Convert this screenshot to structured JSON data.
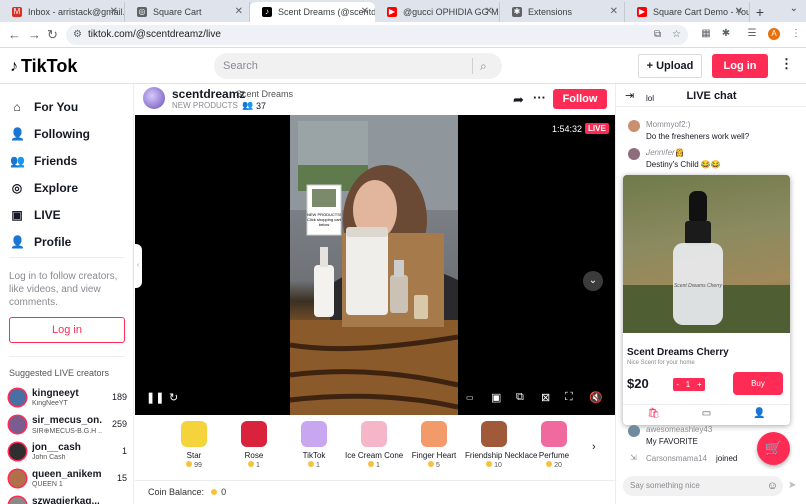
{
  "browser": {
    "tabs": [
      {
        "title": "Inbox - arristack@gmail.c",
        "icon": "gmail-icon",
        "color": "#d93025",
        "glyph": "M"
      },
      {
        "title": "Square Cart",
        "icon": "globe-icon",
        "color": "#5f6368",
        "glyph": "◎"
      },
      {
        "title": "Scent Dreams (@scentdre",
        "icon": "tiktok-icon",
        "color": "#000000",
        "glyph": "♪"
      },
      {
        "title": "@gucci OPHIDIA GG MIN",
        "icon": "youtube-icon",
        "color": "#ff0000",
        "glyph": "▶"
      },
      {
        "title": "Extensions",
        "icon": "puzzle-icon",
        "color": "#5f6368",
        "glyph": "✱"
      },
      {
        "title": "Square Cart Demo - YouT",
        "icon": "youtube-icon",
        "color": "#ff0000",
        "glyph": "▶"
      }
    ],
    "active_tab": 2,
    "new_tab": "+",
    "url": "tiktok.com/@scentdreamz/live",
    "profile_initial": "A"
  },
  "header": {
    "logo_text": "TikTok",
    "search_placeholder": "Search",
    "upload_label": "Upload",
    "login_label": "Log in"
  },
  "sidebar": {
    "nav": [
      {
        "label": "For You",
        "icon": "home-icon",
        "glyph": "⌂"
      },
      {
        "label": "Following",
        "icon": "user-follow-icon",
        "glyph": "👤"
      },
      {
        "label": "Friends",
        "icon": "friends-icon",
        "glyph": "👥"
      },
      {
        "label": "Explore",
        "icon": "compass-icon",
        "glyph": "◎"
      },
      {
        "label": "LIVE",
        "icon": "live-icon",
        "glyph": "▣"
      },
      {
        "label": "Profile",
        "icon": "profile-icon",
        "glyph": "👤"
      }
    ],
    "login_note": "Log in to follow creators, like videos, and view comments.",
    "login_button": "Log in",
    "suggested_title": "Suggested LIVE creators",
    "creators": [
      {
        "name": "kingneeyt",
        "sub": "KingNeeYT",
        "count": "189",
        "color": "#4a6fa5"
      },
      {
        "name": "sir_mecus_on...",
        "sub": "SIR⊕MECUS-B.G.H ...",
        "count": "259",
        "color": "#7a5c8e"
      },
      {
        "name": "jon__cash",
        "sub": "John Cash",
        "count": "1",
        "color": "#2f2f2f"
      },
      {
        "name": "queen_anikemi",
        "sub": "QUEEN 1",
        "count": "15",
        "color": "#b0704a"
      },
      {
        "name": "szwagierkag...",
        "sub": "",
        "count": "",
        "color": "#8a8a8a"
      }
    ]
  },
  "host": {
    "username": "scentdreamz",
    "nickname": "Scent Dreams",
    "tag": "NEW PRODUCTS",
    "viewers": "37",
    "follow_label": "Follow"
  },
  "video": {
    "elapsed": "1:54:32",
    "live_badge": "LIVE",
    "sign_text": "NEW PRODUCTS! Click shopping cart below"
  },
  "gifts": [
    {
      "name": "Star",
      "price": "99",
      "color": "#f5d33b"
    },
    {
      "name": "Rose",
      "price": "1",
      "color": "#d9233c"
    },
    {
      "name": "TikTok",
      "price": "1",
      "color": "#c9a6f0"
    },
    {
      "name": "Ice Cream Cone",
      "price": "1",
      "color": "#f4b6c8"
    },
    {
      "name": "Finger Heart",
      "price": "5",
      "color": "#f39a6b"
    },
    {
      "name": "Friendship Necklace",
      "price": "10",
      "color": "#a05a3a"
    },
    {
      "name": "Perfume",
      "price": "20",
      "color": "#f06aa0"
    }
  ],
  "coin_balance_label": "Coin Balance:",
  "coin_balance": "0",
  "chat": {
    "title": "LIVE chat",
    "messages": [
      {
        "user": "",
        "text": "lol",
        "color": "#c9c9c9"
      },
      {
        "user": "Mommyof2:)",
        "text": "Do the fresheners work well?",
        "color": "#c98f6e"
      },
      {
        "user": "𝐽𝑒𝑛𝑛𝑖𝑓𝑒𝑟👸",
        "text": "Destiny's Child 😂😂",
        "color": "#8e6c7c"
      }
    ],
    "lower_messages": [
      {
        "user": "awesomeashley43",
        "text": "My FAVORITE",
        "color": "#6e8c9e"
      }
    ],
    "join_notice": {
      "user": "Carsonsmama14",
      "text": "joined"
    },
    "input_placeholder": "Say something nice"
  },
  "product": {
    "name": "Scent Dreams Cherry",
    "description": "Nice Scent for your home",
    "price": "$20",
    "quantity": "1",
    "buy_label": "Buy",
    "bottle_label": "Scent Dreams Cherry"
  }
}
